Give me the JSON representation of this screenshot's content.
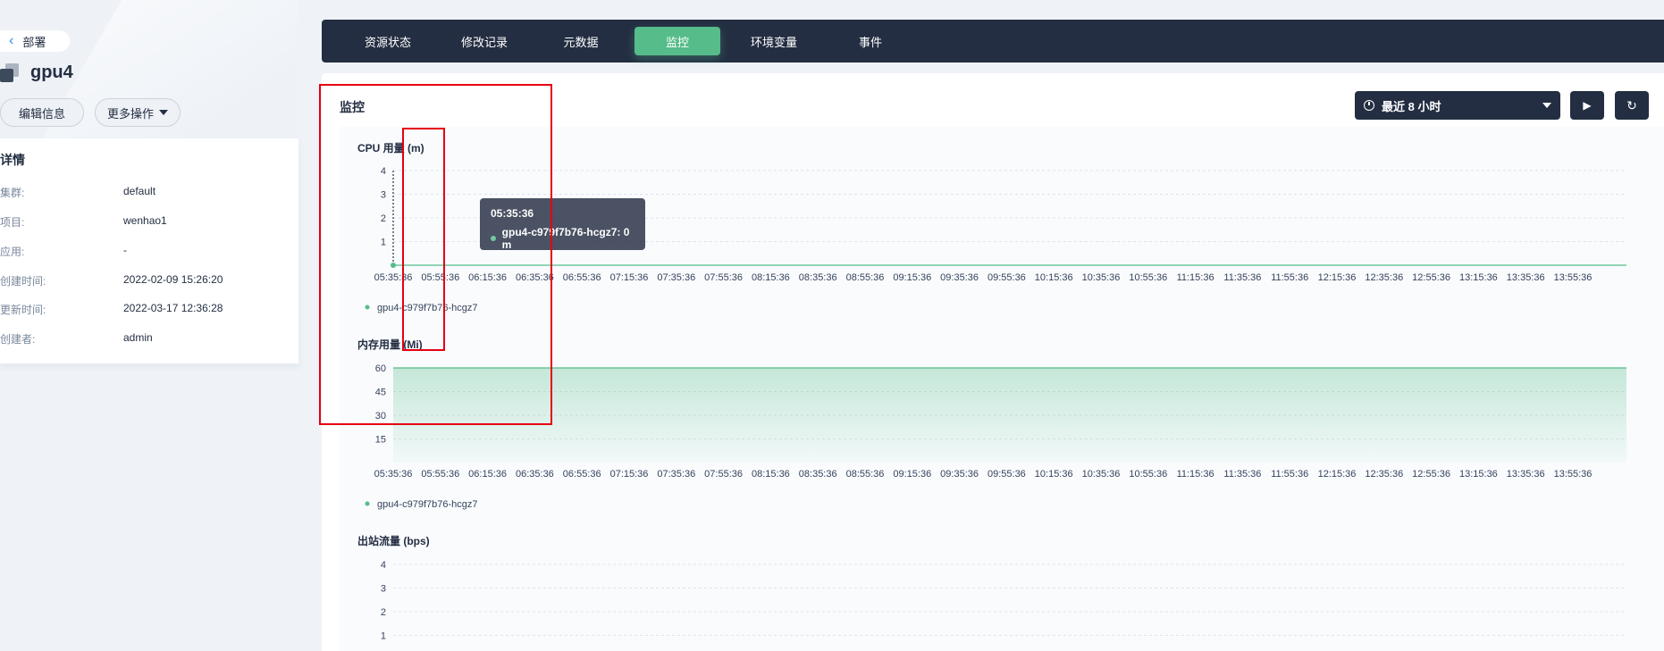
{
  "left": {
    "back_label": "部署",
    "title": "gpu4",
    "edit_label": "编辑信息",
    "more_label": "更多操作",
    "details_title": "详情",
    "details": [
      {
        "key": "集群:",
        "value": "default"
      },
      {
        "key": "项目:",
        "value": "wenhao1"
      },
      {
        "key": "应用:",
        "value": "-"
      },
      {
        "key": "创建时间:",
        "value": "2022-02-09 15:26:20"
      },
      {
        "key": "更新时间:",
        "value": "2022-03-17 12:36:28"
      },
      {
        "key": "创建者:",
        "value": "admin"
      }
    ]
  },
  "tabs": [
    {
      "label": "资源状态",
      "active": false
    },
    {
      "label": "修改记录",
      "active": false
    },
    {
      "label": "元数据",
      "active": false
    },
    {
      "label": "监控",
      "active": true
    },
    {
      "label": "环境变量",
      "active": false
    },
    {
      "label": "事件",
      "active": false
    }
  ],
  "monitor": {
    "title": "监控",
    "time_range": "最近 8 小时",
    "play_icon": "play-icon",
    "refresh_icon": "refresh-icon"
  },
  "tooltip": {
    "time": "05:35:36",
    "series": "gpu4-c979f7b76-hcgz7: 0 m"
  },
  "colors": {
    "dark": "#242e42",
    "accent": "#55bc8a",
    "annotation": "#e60012"
  },
  "chart_data": [
    {
      "type": "line",
      "title": "CPU 用量 (m)",
      "x": [
        "05:35:36",
        "05:55:36",
        "06:15:36",
        "06:35:36",
        "06:55:36",
        "07:15:36",
        "07:35:36",
        "07:55:36",
        "08:15:36",
        "08:35:36",
        "08:55:36",
        "09:15:36",
        "09:35:36",
        "09:55:36",
        "10:15:36",
        "10:35:36",
        "10:55:36",
        "11:15:36",
        "11:35:36",
        "11:55:36",
        "12:15:36",
        "12:35:36",
        "12:55:36",
        "13:15:36",
        "13:35:36",
        "13:55:36"
      ],
      "yticks": [
        1,
        2,
        3,
        4
      ],
      "ylim": [
        0,
        4
      ],
      "series": [
        {
          "name": "gpu4-c979f7b76-hcgz7",
          "values": [
            0,
            0,
            0,
            0,
            0,
            0,
            0,
            0,
            0,
            0,
            0,
            0,
            0,
            0,
            0,
            0,
            0,
            0,
            0,
            0,
            0,
            0,
            0,
            0,
            0,
            0
          ]
        }
      ],
      "grid": true,
      "legend": "bottom-left"
    },
    {
      "type": "area",
      "title": "内存用量 (Mi)",
      "x": [
        "05:35:36",
        "05:55:36",
        "06:15:36",
        "06:35:36",
        "06:55:36",
        "07:15:36",
        "07:35:36",
        "07:55:36",
        "08:15:36",
        "08:35:36",
        "08:55:36",
        "09:15:36",
        "09:35:36",
        "09:55:36",
        "10:15:36",
        "10:35:36",
        "10:55:36",
        "11:15:36",
        "11:35:36",
        "11:55:36",
        "12:15:36",
        "12:35:36",
        "12:55:36",
        "13:15:36",
        "13:35:36",
        "13:55:36"
      ],
      "yticks": [
        15,
        30,
        45,
        60
      ],
      "ylim": [
        0,
        60
      ],
      "series": [
        {
          "name": "gpu4-c979f7b76-hcgz7",
          "values": [
            60,
            60,
            60,
            60,
            60,
            60,
            60,
            60,
            60,
            60,
            60,
            60,
            60,
            60,
            60,
            60,
            60,
            60,
            60,
            60,
            60,
            60,
            60,
            60,
            60,
            60
          ]
        }
      ],
      "grid": true,
      "legend": "bottom-left"
    },
    {
      "type": "line",
      "title": "出站流量 (bps)",
      "yticks": [
        1,
        2,
        3,
        4
      ],
      "ylim": [
        0,
        4
      ],
      "series": [],
      "grid": true
    }
  ]
}
